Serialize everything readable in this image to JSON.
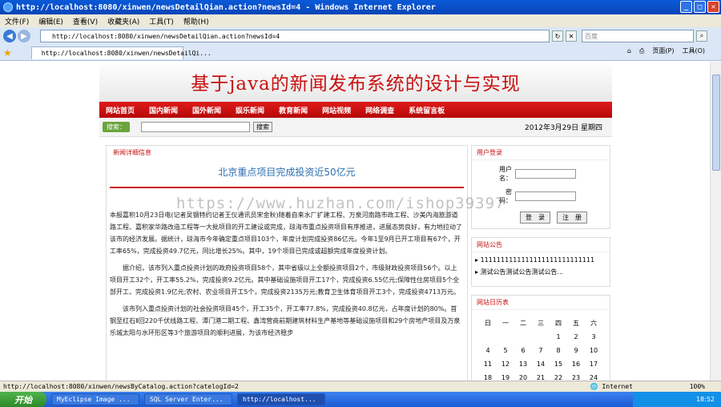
{
  "window": {
    "title": "http://localhost:8080/xinwen/newsDetailQian.action?newsId=4 - Windows Internet Explorer"
  },
  "menu": [
    "文件(F)",
    "编辑(E)",
    "查看(V)",
    "收藏夹(A)",
    "工具(T)",
    "帮助(H)"
  ],
  "address": {
    "url": "http://localhost:8080/xinwen/newsDetailQian.action?newsId=4",
    "search_placeholder": "百度"
  },
  "tab": {
    "label": "http://localhost:8080/xinwen/newsDetailQi...",
    "page_label": "页面(P)",
    "tools_label": "工具(O)"
  },
  "site": {
    "title": "基于java的新闻发布系统的设计与实现",
    "nav": [
      "网站首页",
      "国内新闻",
      "国外新闻",
      "娱乐新闻",
      "教育新闻",
      "网站视频",
      "网络调查",
      "系统留言板"
    ],
    "search_label": "搜索：",
    "search_button": "搜索",
    "date": "2012年3月29日 星期四"
  },
  "article": {
    "section": "新闻详细信息",
    "headline": "北京重点项目完成投资近50亿元",
    "paragraphs": [
      "本报嘉积10月23日电(记者吴钢特约记者王仪通讯员宋金秋)随着自来水厂扩建工程、万泉河南路市政工程、沙美内海旅游道路工程、嘉积家华路改造工程等一大批项目的开工建设或完成，琼海市重点投资项目有序推进，进展态势良好，有力地拉动了该市的经济发展。据统计，琼海市今年确定重点项目103个，年度计划完成投资86亿元。今年1至9月已开工项目有67个，开工率65%，完成投资49.7亿元，同比增长25%。其中，19个项目已完成或超额完成年度投资计划。",
      "据介绍，该市列入重点投资计划的政府投资项目58个，其中省级以上全额投资项目2个，市级财政投资项目56个。以上项目开工32个，开工率55.2%，完成投资9.2亿元。其中基础设施项目开工17个，完成投资6.55亿元;保障性住房项目5个全部开工，完成投资1.9亿元;农村、农业项目开工5个，完成投资2135万元;教育卫生体育项目开工3个，完成投资4713万元。",
      "该市列入重点投资计划的社会投资项目45个，开工35个，开工率77.8%，完成投资40.8亿元，占年度计划的80%。首钢至红石Ⅱ回220千伏线路工程、潭门港二期工程、鑫湾营商前期建筑材料生产基地等基础设施项目和29个房地产项目及万泉乐城太阳与水环形区等3个旅游项目的顺利进展，为该市经济稳步"
    ]
  },
  "sidebar": {
    "login_title": "用户登录",
    "username_label": "用户名：",
    "password_label": "密　码：",
    "login_button": "登　录",
    "register_button": "注　册",
    "notice_title": "网站公告",
    "notices": [
      "1111111111111111111111111111",
      "测试公告测试公告测试公告..."
    ],
    "calendar_title": "网站日历表",
    "weekdays": [
      "日",
      "一",
      "二",
      "三",
      "四",
      "五",
      "六"
    ],
    "calendar_rows": [
      [
        "",
        "",
        "",
        "",
        "1",
        "2",
        "3"
      ],
      [
        "4",
        "5",
        "6",
        "7",
        "8",
        "9",
        "10"
      ],
      [
        "11",
        "12",
        "13",
        "14",
        "15",
        "16",
        "17"
      ],
      [
        "18",
        "19",
        "20",
        "21",
        "22",
        "23",
        "24"
      ]
    ]
  },
  "watermark": "https://www.huzhan.com/ishop39397",
  "status": {
    "url": "http://localhost:8080/xinwen/newsByCatalog.action?catelogId=2",
    "zone": "Internet",
    "zoom": "100%"
  },
  "taskbar": {
    "start": "开始",
    "tasks": [
      "MyEclipse Image ...",
      "SQL Server Enter...",
      "http://localhost..."
    ],
    "clock": "18:52"
  }
}
